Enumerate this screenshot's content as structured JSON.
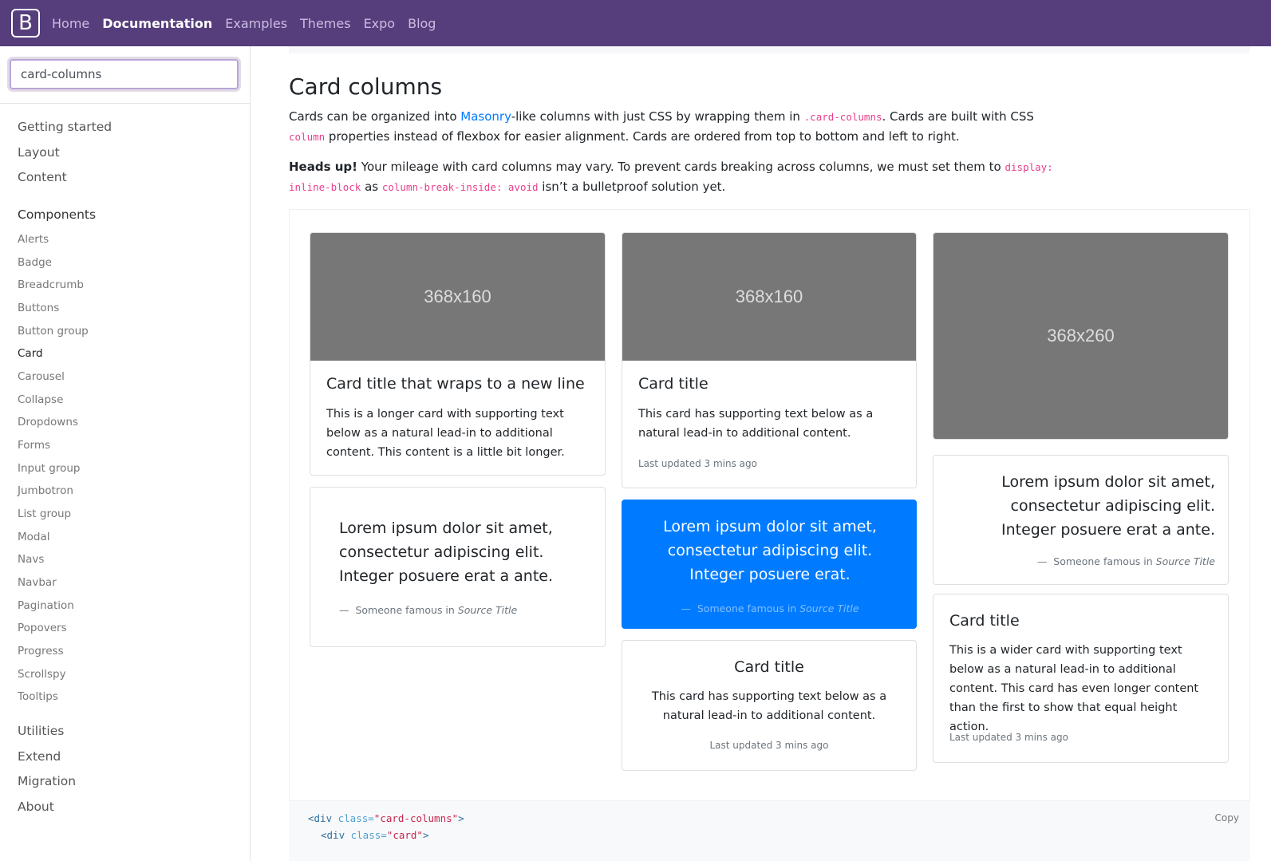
{
  "navbar": {
    "brand": "B",
    "links": [
      "Home",
      "Documentation",
      "Examples",
      "Themes",
      "Expo",
      "Blog"
    ]
  },
  "sidebar": {
    "search_value": "card-columns",
    "groups": [
      "Getting started",
      "Layout",
      "Content",
      "Components",
      "Utilities",
      "Extend",
      "Migration",
      "About"
    ],
    "components": [
      "Alerts",
      "Badge",
      "Breadcrumb",
      "Buttons",
      "Button group",
      "Card",
      "Carousel",
      "Collapse",
      "Dropdowns",
      "Forms",
      "Input group",
      "Jumbotron",
      "List group",
      "Modal",
      "Navs",
      "Navbar",
      "Pagination",
      "Popovers",
      "Progress",
      "Scrollspy",
      "Tooltips"
    ]
  },
  "main": {
    "title": "Card columns",
    "intro": {
      "t1": "Cards can be organized into ",
      "link": "Masonry",
      "t2": "-like columns with just CSS by wrapping them in ",
      "code1": ".card-columns",
      "t3": ". Cards are built with CSS ",
      "code2": "column",
      "t4": " properties instead of flexbox for easier alignment. Cards are ordered from top to bottom and left to right."
    },
    "headsup": {
      "strong": "Heads up!",
      "t1": " Your mileage with card columns may vary. To prevent cards breaking across columns, we must set them to ",
      "code1": "display: inline-block",
      "t2": " as ",
      "code2": "column-break-inside: avoid",
      "t3": " isn’t a bulletproof solution yet."
    },
    "cards": {
      "c1": {
        "img": "368x160",
        "title": "Card title that wraps to a new line",
        "text": "This is a longer card with supporting text below as a natural lead-in to additional content. This content is a little bit longer."
      },
      "c2": {
        "quote": "Lorem ipsum dolor sit amet, consectetur adipiscing elit. Integer posuere erat a ante.",
        "footer_pre": "Someone famous in ",
        "footer_cite": "Source Title"
      },
      "c3": {
        "img": "368x160",
        "title": "Card title",
        "text": "This card has supporting text below as a natural lead-in to additional content.",
        "meta": "Last updated 3 mins ago"
      },
      "c4": {
        "quote": "Lorem ipsum dolor sit amet, consectetur adipiscing elit. Integer posuere erat.",
        "footer_pre": "Someone famous in ",
        "footer_cite": "Source Title",
        "bg": "#007bff"
      },
      "c5": {
        "title": "Card title",
        "text": "This card has supporting text below as a natural lead-in to additional content.",
        "meta": "Last updated 3 mins ago"
      },
      "c6": {
        "img": "368x260"
      },
      "c7": {
        "quote": "Lorem ipsum dolor sit amet, consectetur adipiscing elit. Integer posuere erat a ante.",
        "footer_pre": "Someone famous in ",
        "footer_cite": "Source Title"
      },
      "c8": {
        "title": "Card title",
        "text": "This is a wider card with supporting text below as a natural lead-in to additional content. This card has even longer content than the first to show that equal height action.",
        "meta": "Last updated 3 mins ago"
      }
    },
    "code": {
      "copy": "Copy",
      "line1_tag": "<div",
      "line1_attr": " class=",
      "line1_str": "\"card-columns\"",
      "line1_end": ">",
      "line2_tag": "<div",
      "line2_attr": " class=",
      "line2_str": "\"card\"",
      "line2_end": ">"
    }
  }
}
